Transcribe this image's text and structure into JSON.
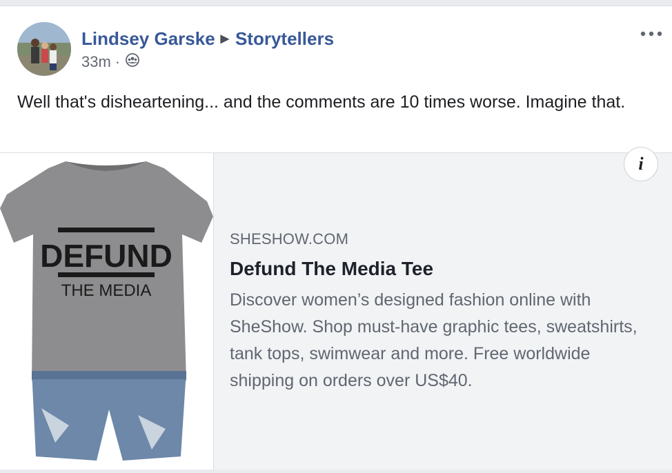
{
  "post": {
    "author": "Lindsey Garske",
    "group": "Storytellers",
    "time": "33m",
    "separator": "·",
    "privacy_icon": "group-members-icon",
    "message": "Well that's disheartening... and the comments are 10 times worse. Imagine that.",
    "more_icon": "more-options-icon"
  },
  "attachment": {
    "domain": "SHESHOW.COM",
    "title": "Defund The Media Tee",
    "description": "Discover women’s designed fashion online with SheShow. Shop must-have graphic tees, sweatshirts, tank tops, swimwear and more. Free worldwide shipping on orders over US$40.",
    "info_label": "i",
    "shirt_text_line1": "DEFUND",
    "shirt_text_line2": "THE MEDIA"
  },
  "colors": {
    "link_blue": "#385898",
    "text_dark": "#1c1e21",
    "meta_gray": "#606770",
    "attachment_bg": "#f2f3f5"
  }
}
